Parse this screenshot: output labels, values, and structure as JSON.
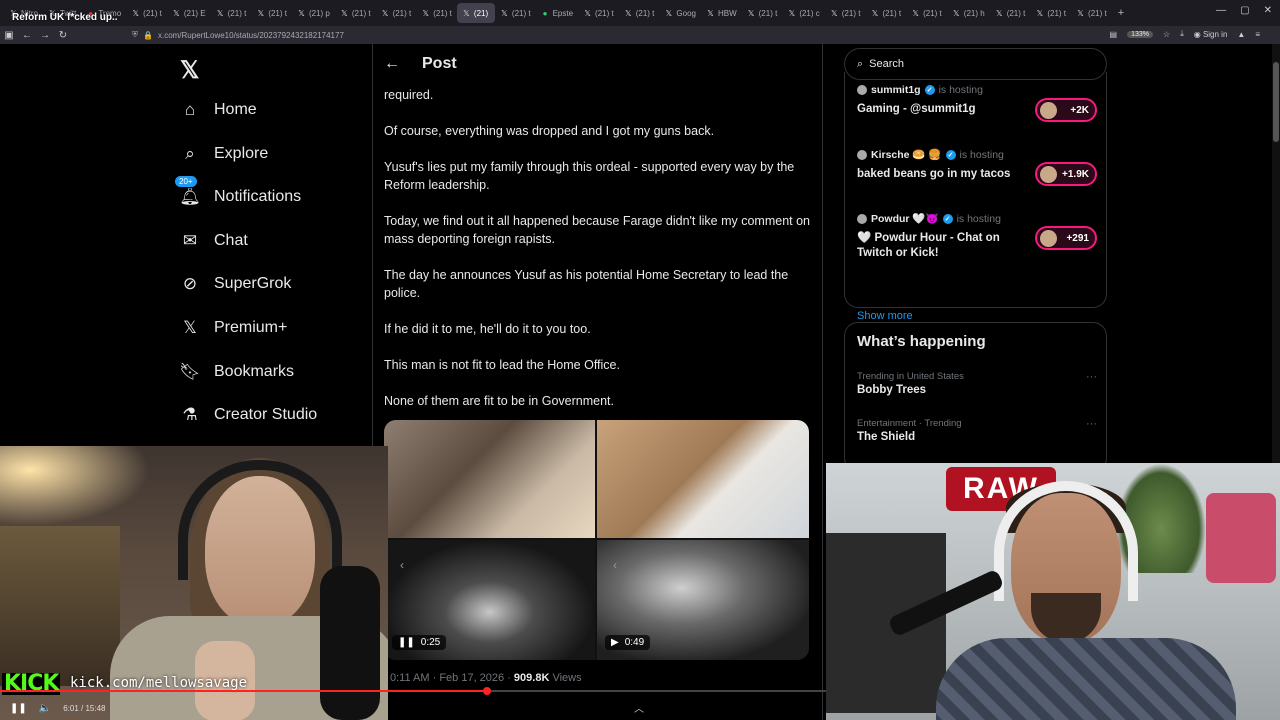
{
  "browser": {
    "page_title": "Reform UK f*cked up..",
    "tabs": [
      {
        "label": "Nitro",
        "icon": "x"
      },
      {
        "label": "Twitt",
        "icon": "x"
      },
      {
        "label": "Tremo",
        "icon": "red"
      },
      {
        "label": "(21) t",
        "icon": "x"
      },
      {
        "label": "(21) E",
        "icon": "x"
      },
      {
        "label": "(21) t",
        "icon": "x"
      },
      {
        "label": "(21) t",
        "icon": "x"
      },
      {
        "label": "(21) p",
        "icon": "x"
      },
      {
        "label": "(21) t",
        "icon": "x"
      },
      {
        "label": "(21) t",
        "icon": "x"
      },
      {
        "label": "(21) t",
        "icon": "x"
      },
      {
        "label": "(21) ",
        "icon": "x",
        "active": true
      },
      {
        "label": "(21) t",
        "icon": "x"
      },
      {
        "label": "Epste",
        "icon": "green"
      },
      {
        "label": "(21) t",
        "icon": "x"
      },
      {
        "label": "(21) t",
        "icon": "x"
      },
      {
        "label": "Goog",
        "icon": "x"
      },
      {
        "label": "HBW",
        "icon": "x"
      },
      {
        "label": "(21) t",
        "icon": "x"
      },
      {
        "label": "(21) c",
        "icon": "x"
      },
      {
        "label": "(21) t",
        "icon": "x"
      },
      {
        "label": "(21) t",
        "icon": "x"
      },
      {
        "label": "(21) t",
        "icon": "x"
      },
      {
        "label": "(21) h",
        "icon": "x"
      },
      {
        "label": "(21) t",
        "icon": "x"
      },
      {
        "label": "(21) t",
        "icon": "x"
      },
      {
        "label": "(21) t",
        "icon": "x"
      }
    ],
    "new_tab": "+",
    "url": "x.com/RupertLowe10/status/2023792432182174177",
    "zoom": "133%",
    "sign_in": "Sign in"
  },
  "nav": {
    "items": [
      {
        "name": "home",
        "label": "Home",
        "icon": "home-icon"
      },
      {
        "name": "explore",
        "label": "Explore",
        "icon": "search-icon"
      },
      {
        "name": "notifications",
        "label": "Notifications",
        "icon": "bell-icon",
        "badge": "20+"
      },
      {
        "name": "chat",
        "label": "Chat",
        "icon": "mail-icon"
      },
      {
        "name": "supergrok",
        "label": "SuperGrok",
        "icon": "grok-icon"
      },
      {
        "name": "premium",
        "label": "Premium+",
        "icon": "x-icon"
      },
      {
        "name": "bookmarks",
        "label": "Bookmarks",
        "icon": "bookmark-icon"
      },
      {
        "name": "creator-studio",
        "label": "Creator Studio",
        "icon": "flask-icon"
      }
    ]
  },
  "post": {
    "header_title": "Post",
    "paragraphs": [
      "required.",
      "Of course, everything was dropped and I got my guns back.",
      "Yusuf's lies put my family through this ordeal - supported every way by the Reform leadership.",
      "Today, we find out it all happened because Farage didn't like my comment on mass deporting foreign rapists.",
      "The day he announces Yusuf as his potential Home Secretary to lead the police.",
      "If he did it to me, he'll do it to you too.",
      "This man is not fit to lead the Home Office.",
      "None of them are fit to be in Government."
    ],
    "media": [
      {
        "duration": "0:25",
        "state": "pause"
      },
      {
        "duration": "0:49",
        "state": "play"
      }
    ],
    "meta_time": "0:11 AM · Feb 17, 2026 · ",
    "meta_views": "909.8K",
    "meta_views_label": " Views"
  },
  "sidebar": {
    "search_placeholder": "Search",
    "spaces": [
      {
        "host": "summit1g",
        "hosting": "is hosting",
        "title": "Gaming - @summit1g",
        "listeners": "+2K"
      },
      {
        "host": "Kirsche 🥯 🍔",
        "hosting": "is hosting",
        "title": "baked beans go in my tacos",
        "listeners": "+1.9K"
      },
      {
        "host": "Powdur 🤍😈",
        "hosting": "is hosting",
        "title": "🤍 Powdur Hour - Chat on Twitch or  Kick!",
        "listeners": "+291"
      }
    ],
    "show_more": "Show more",
    "happening_title": "What’s happening",
    "trends": [
      {
        "context": "Trending in United States",
        "name": "Bobby Trees"
      },
      {
        "context": "Entertainment · Trending",
        "name": "The Shield"
      }
    ]
  },
  "stream": {
    "kick_logo": "KICK",
    "kick_url": "kick.com/mellowsavage",
    "cam_sign": "RAW",
    "time": "6:01 / 15:48",
    "progress": 0.59
  }
}
